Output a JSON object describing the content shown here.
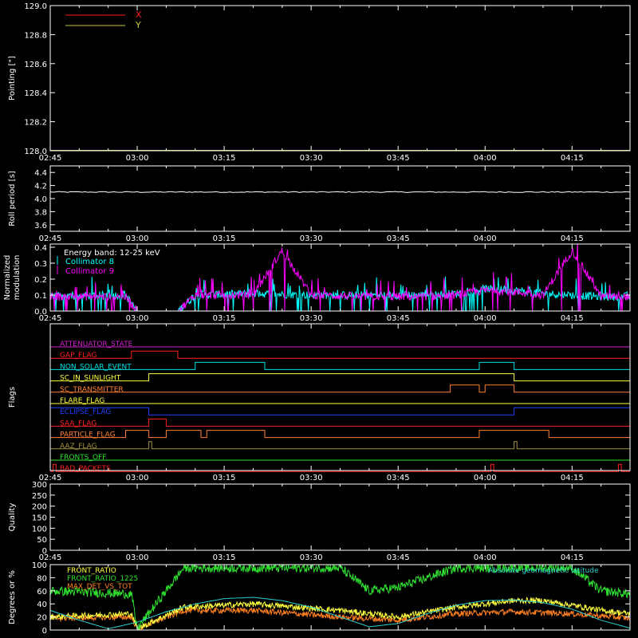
{
  "time_ticks": [
    "02:45",
    "03:00",
    "03:15",
    "03:30",
    "03:45",
    "04:00",
    "04:15"
  ],
  "time_range": [
    "02:45",
    "04:25"
  ],
  "colors": {
    "background": "#000000",
    "frame": "#ffffff",
    "x": "#ff2020",
    "y": "#d0c840",
    "roll": "#ffffff",
    "coll8": "#00ffff",
    "coll9": "#ff00ff",
    "attenuator": "#d020d0",
    "gap": "#ff2020",
    "nonsolar": "#00e0e0",
    "sunlight": "#ffff40",
    "transmitter": "#ff8030",
    "flare": "#ffff40",
    "eclipse": "#2040ff",
    "saa": "#ff2020",
    "particle": "#ff8030",
    "aaz": "#a09040",
    "fronts_off": "#30e030",
    "bad_packets": "#ff2020",
    "front_ratio": "#ffff40",
    "front_ratio_1225": "#30e030",
    "max_det": "#ff8020",
    "geomag": "#30d0d0"
  },
  "chart_data": [
    {
      "id": "pointing",
      "type": "line",
      "ylabel": "Pointing [\"]",
      "ylim": [
        128.0,
        129.0
      ],
      "yticks": [
        "129.0",
        "128.8",
        "128.6",
        "128.4",
        "128.2",
        "128.0"
      ],
      "legend": [
        {
          "name": "X",
          "color_key": "x"
        },
        {
          "name": "Y",
          "color_key": "y"
        }
      ],
      "series": [
        {
          "name": "X",
          "color_key": "x",
          "x": [
            "02:45",
            "04:25"
          ],
          "values": [
            128.0,
            128.0
          ]
        },
        {
          "name": "Y",
          "color_key": "y",
          "x": [
            "02:45",
            "04:25"
          ],
          "values": [
            128.0,
            128.0
          ]
        }
      ]
    },
    {
      "id": "roll",
      "type": "line",
      "ylabel": "Roll period [s]",
      "ylim": [
        3.5,
        4.5
      ],
      "yticks": [
        "4.4",
        "4.2",
        "4.0",
        "3.8",
        "3.6"
      ],
      "series": [
        {
          "name": "",
          "color_key": "roll",
          "x": [
            "02:45",
            "04:25"
          ],
          "values": [
            4.1,
            4.1
          ]
        }
      ]
    },
    {
      "id": "modulation",
      "type": "line",
      "ylabel": [
        "Normalized",
        "modulation"
      ],
      "ylim": [
        0.0,
        0.42
      ],
      "yticks": [
        "0.4",
        "0.3",
        "0.2",
        "0.1",
        "0.0"
      ],
      "annotation": "Energy band: 12-25 keV",
      "legend": [
        {
          "name": "Collimator 8",
          "color_key": "coll8"
        },
        {
          "name": "Collimator 9",
          "color_key": "coll9"
        }
      ],
      "series": [
        {
          "name": "Collimator 8",
          "color_key": "coll8",
          "x": [
            "02:45",
            "02:55",
            "02:58",
            "03:00",
            "03:07",
            "03:10",
            "03:20",
            "03:30",
            "03:40",
            "03:50",
            "03:55",
            "04:00",
            "04:05",
            "04:10",
            "04:15",
            "04:20",
            "04:25"
          ],
          "values": [
            0.09,
            0.1,
            0.1,
            0.0,
            0.0,
            0.1,
            0.11,
            0.1,
            0.1,
            0.1,
            0.11,
            0.14,
            0.13,
            0.11,
            0.1,
            0.09,
            0.09
          ]
        },
        {
          "name": "Collimator 9",
          "color_key": "coll9",
          "x": [
            "02:45",
            "02:55",
            "02:58",
            "03:00",
            "03:07",
            "03:10",
            "03:20",
            "03:25",
            "03:30",
            "03:40",
            "03:50",
            "03:55",
            "04:00",
            "04:05",
            "04:10",
            "04:15",
            "04:20",
            "04:25"
          ],
          "values": [
            0.09,
            0.09,
            0.09,
            0.0,
            0.0,
            0.1,
            0.1,
            0.38,
            0.1,
            0.09,
            0.09,
            0.1,
            0.13,
            0.12,
            0.1,
            0.38,
            0.09,
            0.09
          ]
        }
      ]
    },
    {
      "id": "flags",
      "type": "line",
      "ylabel": "Flags",
      "flags": [
        {
          "name": "ATTENUATOR_STATE",
          "color_key": "attenuator",
          "high": []
        },
        {
          "name": "GAP_FLAG",
          "color_key": "gap",
          "high": [
            [
              "02:59",
              "03:07"
            ]
          ]
        },
        {
          "name": "NON_SOLAR_EVENT",
          "color_key": "nonsolar",
          "high": [
            [
              "03:10",
              "03:22"
            ],
            [
              "03:59",
              "04:05"
            ]
          ]
        },
        {
          "name": "SC_IN_SUNLIGHT",
          "color_key": "sunlight",
          "high": [
            [
              "03:02",
              "04:05"
            ]
          ]
        },
        {
          "name": "SC_TRANSMITTER",
          "color_key": "transmitter",
          "high": [
            [
              "03:54",
              "03:59"
            ],
            [
              "04:00",
              "04:05"
            ]
          ]
        },
        {
          "name": "FLARE_FLAG",
          "color_key": "flare",
          "high": []
        },
        {
          "name": "ECLIPSE_FLAG",
          "color_key": "eclipse",
          "high": [
            [
              "02:45",
              "03:02"
            ],
            [
              "04:05",
              "04:25"
            ]
          ]
        },
        {
          "name": "SAA_FLAG",
          "color_key": "saa",
          "high": [
            [
              "03:02",
              "03:05"
            ]
          ]
        },
        {
          "name": "PARTICLE_FLAG",
          "color_key": "particle",
          "high": [
            [
              "02:58",
              "03:02"
            ],
            [
              "03:05",
              "03:11"
            ],
            [
              "03:12",
              "03:22"
            ],
            [
              "03:59",
              "04:11"
            ]
          ]
        },
        {
          "name": "AAZ_FLAG",
          "color_key": "aaz",
          "high": [
            [
              "03:02",
              "03:02.5"
            ],
            [
              "04:05",
              "04:05.5"
            ]
          ]
        },
        {
          "name": "FRONTS_OFF",
          "color_key": "fronts_off",
          "high": []
        },
        {
          "name": "BAD_PACKETS",
          "color_key": "bad_packets",
          "high": [
            [
              "02:45.5",
              "02:46"
            ],
            [
              "04:01",
              "04:01.5"
            ],
            [
              "04:23",
              "04:23.5"
            ]
          ]
        }
      ]
    },
    {
      "id": "quality",
      "type": "line",
      "ylabel": "Quality",
      "ylim": [
        0,
        300
      ],
      "yticks": [
        "300",
        "250",
        "200",
        "150",
        "100",
        "50",
        "0"
      ],
      "series": []
    },
    {
      "id": "ratios",
      "type": "line",
      "ylabel": "Degrees or %",
      "ylim": [
        0,
        100
      ],
      "yticks": [
        "100",
        "80",
        "60",
        "40",
        "20",
        "0"
      ],
      "legend": [
        {
          "name": "FRONT_RATIO",
          "color_key": "front_ratio"
        },
        {
          "name": "FRONT_RATIO_1225",
          "color_key": "front_ratio_1225"
        },
        {
          "name": "MAX_DET_VS_TOT",
          "color_key": "max_det"
        },
        {
          "name": "Absolute geomagnetic latitude",
          "color_key": "geomag"
        }
      ],
      "series": [
        {
          "name": "FRONT_RATIO",
          "color_key": "front_ratio",
          "x": [
            "02:45",
            "02:59",
            "03:00",
            "03:08",
            "03:20",
            "03:35",
            "03:45",
            "03:55",
            "04:05",
            "04:10",
            "04:15",
            "04:20",
            "04:25"
          ],
          "values": [
            20,
            25,
            2,
            35,
            40,
            30,
            20,
            35,
            45,
            45,
            38,
            30,
            25
          ]
        },
        {
          "name": "FRONT_RATIO_1225",
          "color_key": "front_ratio_1225",
          "x": [
            "02:45",
            "02:59",
            "03:00",
            "03:08",
            "03:15",
            "03:25",
            "03:35",
            "03:40",
            "03:45",
            "03:55",
            "04:05",
            "04:15",
            "04:20",
            "04:25"
          ],
          "values": [
            60,
            55,
            2,
            95,
            95,
            95,
            95,
            60,
            65,
            95,
            95,
            95,
            60,
            55
          ]
        },
        {
          "name": "MAX_DET_VS_TOT",
          "color_key": "max_det",
          "x": [
            "02:45",
            "02:59",
            "03:00",
            "03:08",
            "03:20",
            "03:35",
            "03:45",
            "03:55",
            "04:05",
            "04:15",
            "04:25"
          ],
          "values": [
            18,
            20,
            2,
            30,
            30,
            20,
            15,
            25,
            28,
            25,
            18
          ]
        },
        {
          "name": "Absolute geomagnetic latitude",
          "color_key": "geomag",
          "x": [
            "02:45",
            "02:50",
            "02:55",
            "03:00",
            "03:05",
            "03:10",
            "03:15",
            "03:20",
            "03:25",
            "03:30",
            "03:35",
            "03:40",
            "03:45",
            "03:50",
            "03:55",
            "04:00",
            "04:05",
            "04:10",
            "04:15",
            "04:20",
            "04:25"
          ],
          "values": [
            30,
            15,
            2,
            12,
            28,
            40,
            48,
            50,
            45,
            35,
            20,
            5,
            10,
            25,
            38,
            45,
            46,
            42,
            32,
            15,
            3
          ]
        }
      ]
    }
  ]
}
